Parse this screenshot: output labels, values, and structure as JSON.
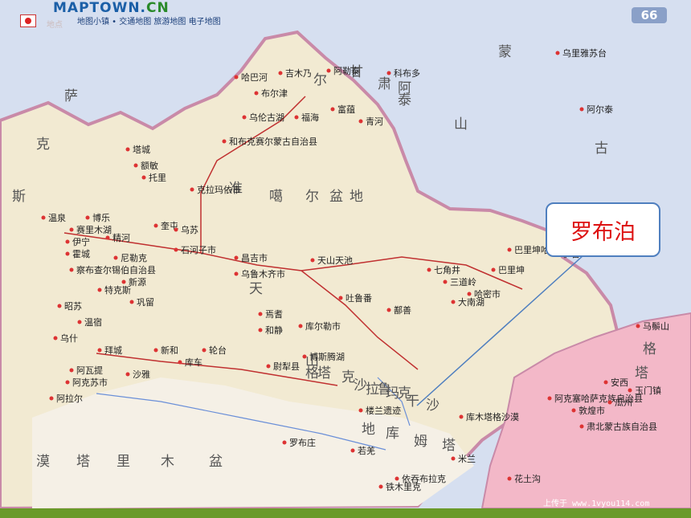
{
  "header": {
    "logo_main": "MAPTOWN.",
    "logo_suffix": "CN",
    "nav": "地图小镇 • 交通地图 旅游地图 电子地图",
    "watermark": "地点",
    "page_number": "66"
  },
  "callout": {
    "text": "罗布泊"
  },
  "credit": "上传于 www.1vyou114.com",
  "colors": {
    "land": "#f2ead2",
    "neighbor": "#d6dff0",
    "desert": "#f5f0e6",
    "gansu": "#f3b8c8",
    "callout_text": "#dd1111",
    "callout_border": "#4f7fbf"
  },
  "labels": {
    "regions": [
      {
        "t": "蒙"
      },
      {
        "t": "古"
      },
      {
        "t": "萨"
      },
      {
        "t": "克"
      },
      {
        "t": "斯"
      },
      {
        "t": "尔"
      },
      {
        "t": "泰"
      },
      {
        "t": "山"
      },
      {
        "t": "准"
      },
      {
        "t": "噶"
      },
      {
        "t": "尔"
      },
      {
        "t": "盆"
      },
      {
        "t": "地"
      },
      {
        "t": "天"
      },
      {
        "t": "山"
      },
      {
        "t": "塔"
      },
      {
        "t": "克"
      },
      {
        "t": "拉"
      },
      {
        "t": "玛"
      },
      {
        "t": "干"
      },
      {
        "t": "沙"
      },
      {
        "t": "漠"
      },
      {
        "t": "塔"
      },
      {
        "t": "里"
      },
      {
        "t": "木"
      },
      {
        "t": "盆"
      },
      {
        "t": "地"
      },
      {
        "t": "库"
      },
      {
        "t": "姆"
      },
      {
        "t": "塔"
      },
      {
        "t": "格"
      },
      {
        "t": "沙"
      },
      {
        "t": "鲁"
      },
      {
        "t": "克"
      },
      {
        "t": "塔"
      },
      {
        "t": "格"
      },
      {
        "t": "甘"
      },
      {
        "t": "肃"
      },
      {
        "t": "阿"
      },
      {
        "t": "勒"
      },
      {
        "t": "泰"
      }
    ],
    "cities": [
      {
        "t": "乌鲁木齐市"
      },
      {
        "t": "昌吉市"
      },
      {
        "t": "石河子市"
      },
      {
        "t": "克拉玛依市"
      },
      {
        "t": "伊宁"
      },
      {
        "t": "库尔勒市"
      },
      {
        "t": "吐鲁番"
      },
      {
        "t": "哈密市"
      },
      {
        "t": "阿勒泰"
      },
      {
        "t": "博乐"
      },
      {
        "t": "奎屯"
      },
      {
        "t": "鄯善"
      },
      {
        "t": "和静"
      },
      {
        "t": "焉耆"
      },
      {
        "t": "若羌"
      },
      {
        "t": "敦煌市"
      },
      {
        "t": "阿克苏市"
      },
      {
        "t": "富蕴"
      },
      {
        "t": "青河"
      },
      {
        "t": "福海"
      },
      {
        "t": "巴里坤"
      },
      {
        "t": "伊吾"
      },
      {
        "t": "尉犁县"
      },
      {
        "t": "轮台"
      },
      {
        "t": "库车"
      },
      {
        "t": "沙雅"
      },
      {
        "t": "新源"
      },
      {
        "t": "尼勒克"
      },
      {
        "t": "精河"
      },
      {
        "t": "托里"
      },
      {
        "t": "和布克赛尔蒙古自治县"
      },
      {
        "t": "巴里坤哈萨克自治县"
      },
      {
        "t": "肃北蒙古族自治县"
      },
      {
        "t": "阿克塞哈萨克族自治县"
      },
      {
        "t": "玉门镇"
      },
      {
        "t": "安西"
      },
      {
        "t": "瓜州"
      },
      {
        "t": "乌里雅苏台"
      },
      {
        "t": "科布多"
      },
      {
        "t": "阿尔泰"
      },
      {
        "t": "七角井"
      },
      {
        "t": "三道岭"
      },
      {
        "t": "大南湖"
      },
      {
        "t": "马鬃山"
      },
      {
        "t": "吉木乃"
      },
      {
        "t": "布尔津"
      },
      {
        "t": "哈巴河"
      },
      {
        "t": "塔城"
      },
      {
        "t": "额敏"
      },
      {
        "t": "乌苏"
      },
      {
        "t": "温泉"
      },
      {
        "t": "霍城"
      },
      {
        "t": "察布查尔锡伯自治县"
      },
      {
        "t": "昭苏"
      },
      {
        "t": "特克斯"
      },
      {
        "t": "巩留"
      },
      {
        "t": "拜城"
      },
      {
        "t": "新和"
      },
      {
        "t": "温宿"
      },
      {
        "t": "乌什"
      },
      {
        "t": "阿瓦提"
      },
      {
        "t": "阿拉尔"
      },
      {
        "t": "罗布庄"
      },
      {
        "t": "米兰"
      },
      {
        "t": "依吞布拉克"
      },
      {
        "t": "花土沟"
      },
      {
        "t": "铁木里克"
      },
      {
        "t": "乌伦古湖"
      },
      {
        "t": "赛里木湖"
      },
      {
        "t": "博斯腾湖"
      },
      {
        "t": "楼兰遗迹"
      },
      {
        "t": "天山天池"
      },
      {
        "t": "库木塔格沙漠"
      }
    ]
  }
}
